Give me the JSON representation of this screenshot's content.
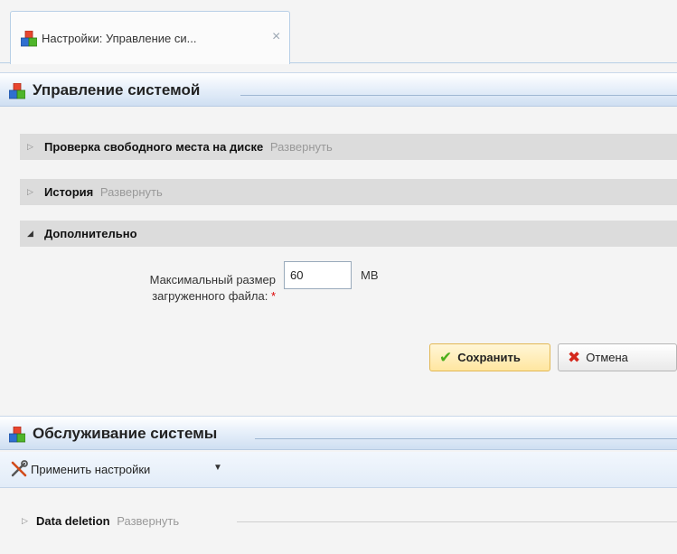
{
  "tab": {
    "title": "Настройки: Управление си...",
    "close_glyph": "×",
    "icon": "blocks-icon"
  },
  "system_management": {
    "title": "Управление системой",
    "sections": [
      {
        "title": "Проверка свободного места на диске",
        "expand_label": "Развернуть",
        "expanded": false
      },
      {
        "title": "История",
        "expand_label": "Развернуть",
        "expanded": false
      },
      {
        "title": "Дополнительно",
        "expanded": true
      }
    ],
    "max_file_size": {
      "label_line1": "Максимальный размер",
      "label_line2": "загруженного файла:",
      "required_mark": "*",
      "value": "60",
      "unit": "MB"
    },
    "buttons": {
      "save": "Сохранить",
      "cancel": "Отмена"
    }
  },
  "system_maintenance": {
    "title": "Обслуживание системы",
    "toolbar": {
      "apply_label": "Применить настройки"
    },
    "sections": [
      {
        "title": "Data deletion",
        "expand_label": "Развернуть",
        "expanded": false
      }
    ]
  },
  "colors": {
    "header_blue": "#cfdff2",
    "save_yellow": "#ffe6a0",
    "check_green": "#4cae1c",
    "cancel_red": "#d4281c"
  }
}
